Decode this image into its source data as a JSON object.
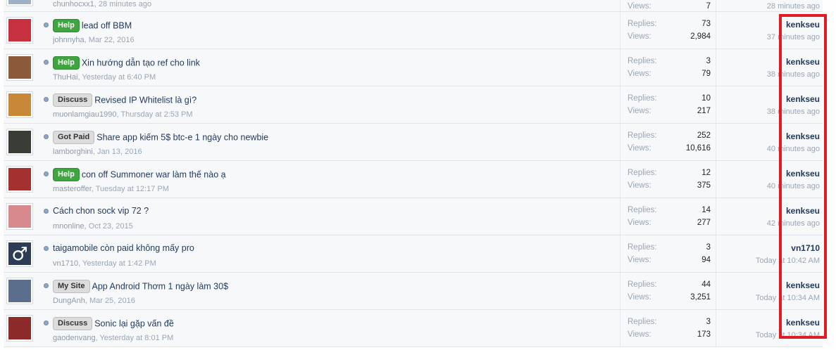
{
  "partial_row": {
    "author": "chunhocxx1",
    "time": "28 minutes ago",
    "views_label": "Views:",
    "views": "7",
    "last_time": "28 minutes ago"
  },
  "labels": {
    "replies": "Replies:",
    "views": "Views:"
  },
  "threads": [
    {
      "prefix": "Help",
      "prefix_color": "#3fa63f",
      "title": "lead off BBM",
      "author": "johnnyha",
      "date": "Mar 22, 2016",
      "replies": "73",
      "views": "2,984",
      "last_user": "kenkseu",
      "last_time": "37 minutes ago",
      "avatar_color": "#c7313f"
    },
    {
      "prefix": "Help",
      "prefix_color": "#3fa63f",
      "title": "Xin hướng dẫn tạo ref cho link",
      "author": "ThuHai",
      "date": "Yesterday at 6:40 PM",
      "replies": "3",
      "views": "79",
      "last_user": "kenkseu",
      "last_time": "38 minutes ago",
      "avatar_color": "#8a5a3b"
    },
    {
      "prefix": "Discuss",
      "prefix_color": "#dcdcdc",
      "title": "Revised IP Whitelist là gì?",
      "author": "muonlamgiau1990",
      "date": "Thursday at 2:53 PM",
      "replies": "10",
      "views": "217",
      "last_user": "kenkseu",
      "last_time": "38 minutes ago",
      "avatar_color": "#c9873a"
    },
    {
      "prefix": "Got Paid",
      "prefix_color": "#dcdcdc",
      "title": "Share app kiếm 5$ btc-e 1 ngày cho newbie",
      "author": "lamborghini",
      "date": "Jan 13, 2016",
      "replies": "252",
      "views": "10,616",
      "last_user": "kenkseu",
      "last_time": "40 minutes ago",
      "avatar_color": "#3a3d36"
    },
    {
      "prefix": "Help",
      "prefix_color": "#3fa63f",
      "title": "con off Summoner war làm thế nào ạ",
      "author": "masteroffer",
      "date": "Tuesday at 12:17 PM",
      "replies": "12",
      "views": "375",
      "last_user": "kenkseu",
      "last_time": "40 minutes ago",
      "avatar_color": "#a3312f"
    },
    {
      "prefix": "",
      "prefix_color": "",
      "title": "Cách chon sock vip 72 ?",
      "author": "mnonline",
      "date": "Oct 23, 2015",
      "replies": "14",
      "views": "277",
      "last_user": "kenkseu",
      "last_time": "42 minutes ago",
      "avatar_color": "#d8898d"
    },
    {
      "prefix": "",
      "prefix_color": "",
      "title": "taigamobile còn paid không mấy pro",
      "author": "vn1710",
      "date": "Yesterday at 1:42 PM",
      "replies": "3",
      "views": "94",
      "last_user": "vn1710",
      "last_time": "Today at 10:42 AM",
      "avatar_color": "#2e3d55",
      "avatar_symbol": "♂"
    },
    {
      "prefix": "My Site",
      "prefix_color": "#dcdcdc",
      "title": "App Android Thơm 1 ngày làm 30$",
      "author": "DungAnh",
      "date": "Mar 25, 2016",
      "replies": "44",
      "views": "3,251",
      "last_user": "kenkseu",
      "last_time": "Today at 10:34 AM",
      "avatar_color": "#5b6f8c"
    },
    {
      "prefix": "Discuss",
      "prefix_color": "#dcdcdc",
      "title": "Sonic lại gặp vấn đề",
      "author": "gaodenvang",
      "date": "Yesterday at 8:01 PM",
      "replies": "3",
      "views": "173",
      "last_user": "kenkseu",
      "last_time": "Today at 10:34 AM",
      "avatar_color": "#8c2a2a"
    }
  ],
  "highlight_color": "#e01b24"
}
